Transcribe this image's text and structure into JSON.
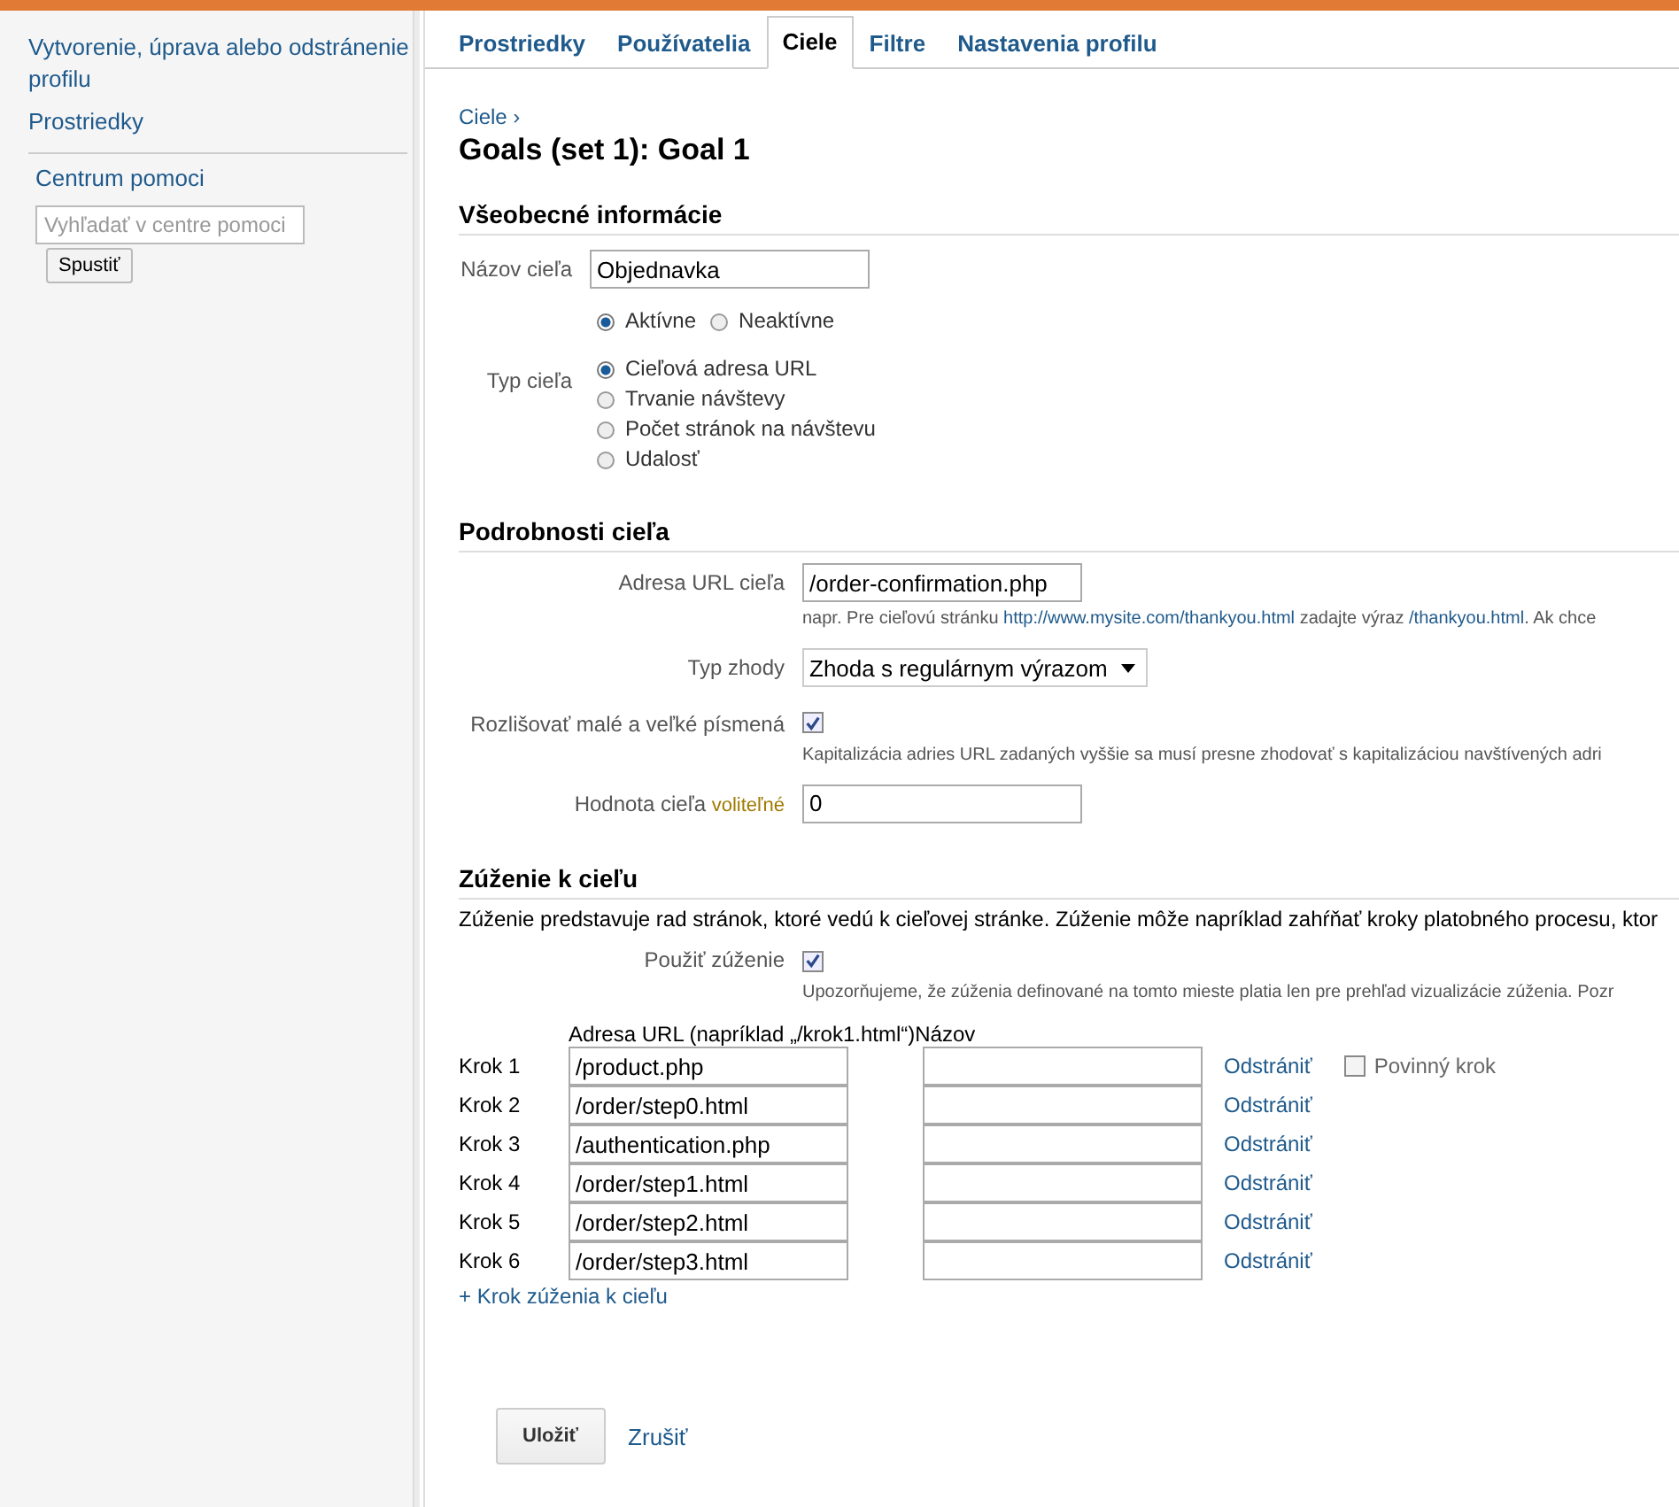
{
  "sidebar": {
    "links": [
      "Vytvorenie, úprava alebo odstránenie profilu",
      "Prostriedky"
    ],
    "help_title": "Centrum pomoci",
    "search": {
      "placeholder": "Vyhľadať v centre pomoci"
    },
    "search_button": "Spustiť"
  },
  "tabs": [
    {
      "label": "Prostriedky",
      "selected": false
    },
    {
      "label": "Používatelia",
      "selected": false
    },
    {
      "label": "Ciele",
      "selected": true
    },
    {
      "label": "Filtre",
      "selected": false
    },
    {
      "label": "Nastavenia profilu",
      "selected": false
    }
  ],
  "breadcrumb": "Ciele ›",
  "title": "Goals (set 1): Goal 1",
  "general": {
    "heading": "Všeobecné informácie",
    "name_label": "Názov cieľa",
    "name_value": "Objednavka",
    "status": [
      {
        "label": "Aktívne",
        "selected": true
      },
      {
        "label": "Neaktívne",
        "selected": false
      }
    ],
    "type_label": "Typ cieľa",
    "types": [
      {
        "label": "Cieľová adresa URL",
        "selected": true
      },
      {
        "label": "Trvanie návštevy",
        "selected": false
      },
      {
        "label": "Počet stránok na návštevu",
        "selected": false
      },
      {
        "label": "Udalosť",
        "selected": false
      }
    ]
  },
  "details": {
    "heading": "Podrobnosti cieľa",
    "url_label": "Adresa URL cieľa",
    "url_value": "/order-confirmation.php",
    "url_hint": [
      {
        "kind": "text",
        "text": "napr. Pre cieľovú stránku "
      },
      {
        "kind": "link",
        "text": "http://www.mysite.com/thankyou.html"
      },
      {
        "kind": "text",
        "text": " zadajte výraz "
      },
      {
        "kind": "link",
        "text": "/thankyou.html"
      },
      {
        "kind": "text",
        "text": ". Ak chce"
      }
    ],
    "match_label": "Typ zhody",
    "match_value": "Zhoda s regulárnym výrazom",
    "case_label": "Rozlišovať malé a veľké písmená",
    "case_checked": true,
    "case_hint": "Kapitalizácia adries URL zadaných vyššie sa musí presne zhodovať s kapitalizáciou navštívených adri",
    "value_label": "Hodnota cieľa",
    "value_optional": "voliteľné",
    "value_value": "0"
  },
  "funnel": {
    "heading": "Zúženie k cieľu",
    "description": "Zúženie predstavuje rad stránok, ktoré vedú k cieľovej stránke. Zúženie môže napríklad zahŕňať kroky platobného procesu, ktor",
    "use_label": "Použiť zúženie",
    "use_checked": true,
    "use_hint": "Upozorňujeme, že zúženia definované na tomto mieste platia len pre prehľad vizualizácie zúženia. Pozr",
    "url_header": "Adresa URL (napríklad „/krok1.html“)",
    "name_header": "Názov",
    "steps": [
      {
        "label": "Krok 1",
        "url": "/product.php",
        "remove": "Odstrániť"
      },
      {
        "label": "Krok 2",
        "url": "/order/step0.html",
        "remove": "Odstrániť"
      },
      {
        "label": "Krok 3",
        "url": "/authentication.php",
        "remove": "Odstrániť"
      },
      {
        "label": "Krok 4",
        "url": "/order/step1.html",
        "remove": "Odstrániť"
      },
      {
        "label": "Krok 5",
        "url": "/order/step2.html",
        "remove": "Odstrániť"
      },
      {
        "label": "Krok 6",
        "url": "/order/step3.html",
        "remove": "Odstrániť"
      }
    ],
    "required_label": "Povinný krok",
    "required_checked": false,
    "add_link": "+ Krok zúženia k cieľu"
  },
  "buttons": {
    "save": "Uložiť",
    "cancel": "Zrušiť"
  }
}
